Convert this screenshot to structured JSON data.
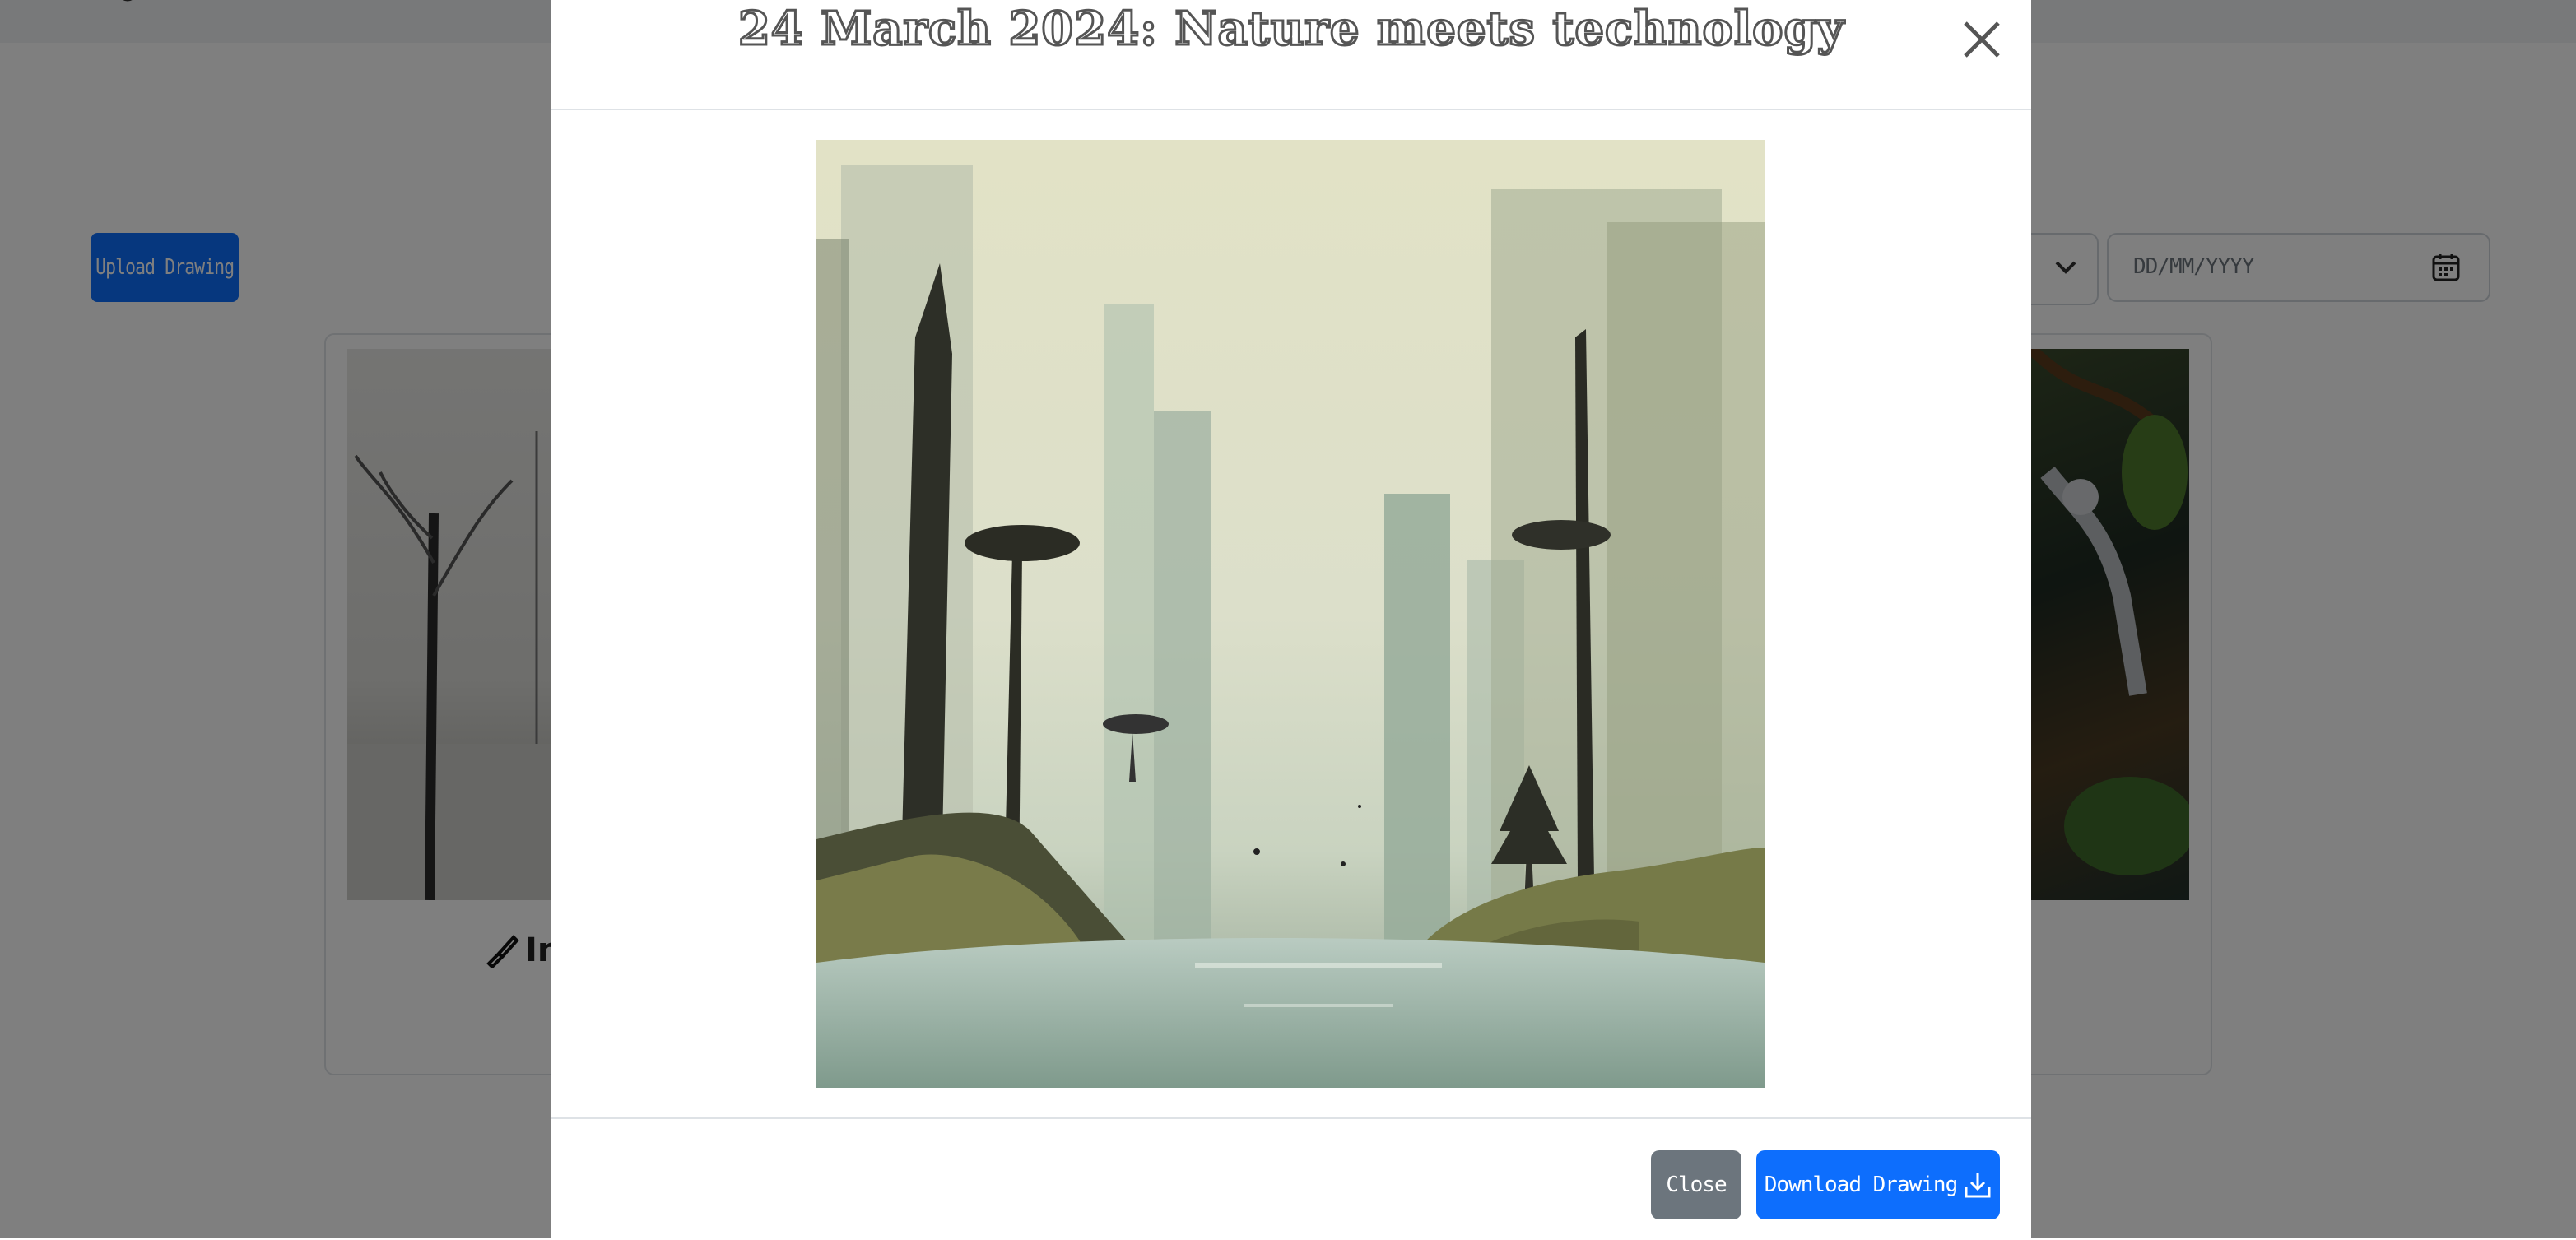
{
  "background_page": {
    "upload_button_label": "Upload Drawing",
    "date_filter_placeholder": "DD/MM/YYYY",
    "card_label_fragment": "In"
  },
  "modal": {
    "title": "24 March 2024: Nature meets technology",
    "close_icon": "close-x-icon",
    "image_alt": "Misty forest with trees and tall grey towers around a still lake",
    "footer": {
      "close_label": "Close",
      "download_label": "Download Drawing",
      "download_icon": "download-icon"
    }
  },
  "colors": {
    "primary": "#0d6efd",
    "secondary": "#6c757d",
    "backdrop": "rgba(0,0,0,0.5)"
  }
}
